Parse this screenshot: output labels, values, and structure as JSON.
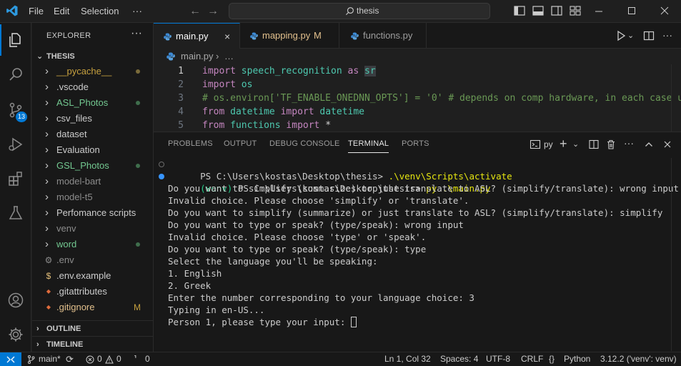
{
  "titlebar": {
    "menu": [
      "File",
      "Edit",
      "Selection",
      "···"
    ],
    "search_text": "thesis"
  },
  "activity": {
    "scm_badge": "13"
  },
  "sidebar": {
    "title": "EXPLORER",
    "root": "THESIS",
    "items": [
      {
        "label": "__pycache__",
        "kind": "folder",
        "color": "#c6a03f",
        "badge": "dot"
      },
      {
        "label": ".vscode",
        "kind": "folder",
        "color": "#cccccc",
        "badge": ""
      },
      {
        "label": "ASL_Photos",
        "kind": "folder",
        "color": "#73c991",
        "badge": "dot-green"
      },
      {
        "label": "csv_files",
        "kind": "folder",
        "color": "#cccccc",
        "badge": ""
      },
      {
        "label": "dataset",
        "kind": "folder",
        "color": "#cccccc",
        "badge": ""
      },
      {
        "label": "Evaluation",
        "kind": "folder",
        "color": "#cccccc",
        "badge": ""
      },
      {
        "label": "GSL_Photos",
        "kind": "folder",
        "color": "#73c991",
        "badge": "dot-green"
      },
      {
        "label": "model-bart",
        "kind": "folder",
        "color": "#8c8c8c",
        "badge": ""
      },
      {
        "label": "model-t5",
        "kind": "folder",
        "color": "#8c8c8c",
        "badge": ""
      },
      {
        "label": "Perfomance scripts",
        "kind": "folder",
        "color": "#cccccc",
        "badge": ""
      },
      {
        "label": "venv",
        "kind": "folder",
        "color": "#8c8c8c",
        "badge": ""
      },
      {
        "label": "word",
        "kind": "folder",
        "color": "#73c991",
        "badge": "dot-green"
      },
      {
        "label": ".env",
        "kind": "gear",
        "color": "#8c8c8c",
        "badge": ""
      },
      {
        "label": ".env.example",
        "kind": "dollar",
        "color": "#cccccc",
        "badge": ""
      },
      {
        "label": ".gitattributes",
        "kind": "git",
        "color": "#cccccc",
        "badge": ""
      },
      {
        "label": ".gitignore",
        "kind": "git",
        "color": "#e2c08d",
        "badge": "M"
      }
    ],
    "sections": [
      "OUTLINE",
      "TIMELINE"
    ]
  },
  "tabs": [
    {
      "label": "main.py",
      "modified": "",
      "active": true
    },
    {
      "label": "mapping.py",
      "modified": "M",
      "active": false
    },
    {
      "label": "functions.py",
      "modified": "",
      "active": false
    }
  ],
  "breadcrumb": {
    "file": "main.py",
    "rest": "…"
  },
  "code": [
    {
      "n": "1",
      "parts": [
        [
          "kw",
          "import "
        ],
        [
          "mod",
          "speech_recognition"
        ],
        [
          "kw",
          " as "
        ],
        [
          "mod hl",
          "sr"
        ]
      ]
    },
    {
      "n": "2",
      "parts": [
        [
          "kw",
          "import "
        ],
        [
          "mod",
          "os"
        ]
      ]
    },
    {
      "n": "3",
      "parts": [
        [
          "cm",
          "# os.environ['TF_ENABLE_ONEDNN_OPTS'] = '0' # depends on comp hardware, in each case un"
        ]
      ]
    },
    {
      "n": "4",
      "parts": [
        [
          "kw",
          "from "
        ],
        [
          "mod",
          "datetime"
        ],
        [
          "kw",
          " import "
        ],
        [
          "mod",
          "datetime"
        ]
      ]
    },
    {
      "n": "5",
      "parts": [
        [
          "kw",
          "from "
        ],
        [
          "mod",
          "functions"
        ],
        [
          "kw",
          " import "
        ],
        [
          "plain",
          "*"
        ]
      ]
    }
  ],
  "panel": {
    "tabs": [
      "PROBLEMS",
      "OUTPUT",
      "DEBUG CONSOLE",
      "TERMINAL",
      "PORTS"
    ],
    "active_tab": "TERMINAL",
    "shell_label": "py"
  },
  "terminal": {
    "line1_prompt": "PS C:\\Users\\kostas\\Desktop\\thesis> ",
    "line1_cmd": ".\\venv\\Scripts\\activate",
    "line2_venv": "(venv) ",
    "line2_prompt": "PS C:\\Users\\kostas\\Desktop\\thesis> ",
    "line2_cmd": "py .\\main.py",
    "output": [
      "Do you want to simplify (summarize) or just translate to ASL? (simplify/translate): wrong input",
      "Invalid choice. Please choose 'simplify' or 'translate'.",
      "Do you want to simplify (summarize) or just translate to ASL? (simplify/translate): simplify",
      "Do you want to type or speak? (type/speak): wrong input",
      "Invalid choice. Please choose 'type' or 'speak'.",
      "Do you want to type or speak? (type/speak): type",
      "Select the language you'll be speaking:",
      "1. English",
      "2. Greek",
      "Enter the number corresponding to your language choice: 3",
      "Typing in en-US...",
      "Person 1, please type your input: "
    ]
  },
  "status": {
    "branch": "main*",
    "errors": "0",
    "warnings": "0",
    "ports": "0",
    "position": "Ln 1, Col 32",
    "spaces": "Spaces: 4",
    "encoding": "UTF-8",
    "eol": "CRLF",
    "language": "Python",
    "interpreter": "3.12.2 ('venv': venv)"
  }
}
